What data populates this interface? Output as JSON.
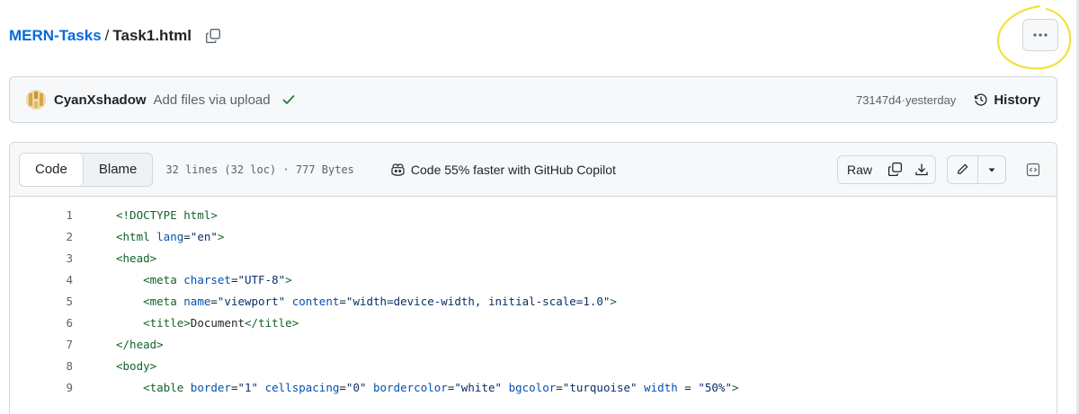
{
  "breadcrumb": {
    "repo": "MERN-Tasks",
    "separator": "/",
    "file": "Task1.html"
  },
  "commit": {
    "author": "CyanXshadow",
    "message": "Add files via upload",
    "sha": "73147d4",
    "separator": " · ",
    "time": "yesterday",
    "history_label": "History"
  },
  "file_header": {
    "tabs": [
      {
        "label": "Code"
      },
      {
        "label": "Blame"
      }
    ],
    "info": "32 lines (32 loc) · 777 Bytes",
    "copilot": "Code 55% faster with GitHub Copilot",
    "raw_label": "Raw"
  },
  "code_lines": [
    {
      "n": "1",
      "tokens": [
        {
          "t": "<!DOCTYPE html>",
          "c": "tg"
        }
      ]
    },
    {
      "n": "2",
      "tokens": [
        {
          "t": "<html ",
          "c": "tg"
        },
        {
          "t": "lang",
          "c": "at"
        },
        {
          "t": "=",
          "c": "tx"
        },
        {
          "t": "\"en\"",
          "c": "st"
        },
        {
          "t": ">",
          "c": "tg"
        }
      ]
    },
    {
      "n": "3",
      "tokens": [
        {
          "t": "<head>",
          "c": "tg"
        }
      ]
    },
    {
      "n": "4",
      "tokens": [
        {
          "t": "    ",
          "c": "tx"
        },
        {
          "t": "<meta ",
          "c": "tg"
        },
        {
          "t": "charset",
          "c": "at"
        },
        {
          "t": "=",
          "c": "tx"
        },
        {
          "t": "\"UTF-8\"",
          "c": "st"
        },
        {
          "t": ">",
          "c": "tg"
        }
      ]
    },
    {
      "n": "5",
      "tokens": [
        {
          "t": "    ",
          "c": "tx"
        },
        {
          "t": "<meta ",
          "c": "tg"
        },
        {
          "t": "name",
          "c": "at"
        },
        {
          "t": "=",
          "c": "tx"
        },
        {
          "t": "\"viewport\"",
          "c": "st"
        },
        {
          "t": " ",
          "c": "tx"
        },
        {
          "t": "content",
          "c": "at"
        },
        {
          "t": "=",
          "c": "tx"
        },
        {
          "t": "\"width=device-width, initial-scale=1.0\"",
          "c": "st"
        },
        {
          "t": ">",
          "c": "tg"
        }
      ]
    },
    {
      "n": "6",
      "tokens": [
        {
          "t": "    ",
          "c": "tx"
        },
        {
          "t": "<title>",
          "c": "tg"
        },
        {
          "t": "Document",
          "c": "tx"
        },
        {
          "t": "</title>",
          "c": "tg"
        }
      ]
    },
    {
      "n": "7",
      "tokens": [
        {
          "t": "</head>",
          "c": "tg"
        }
      ]
    },
    {
      "n": "8",
      "tokens": [
        {
          "t": "<body>",
          "c": "tg"
        }
      ]
    },
    {
      "n": "9",
      "tokens": [
        {
          "t": "    ",
          "c": "tx"
        },
        {
          "t": "<table ",
          "c": "tg"
        },
        {
          "t": "border",
          "c": "at"
        },
        {
          "t": "=",
          "c": "tx"
        },
        {
          "t": "\"1\"",
          "c": "st"
        },
        {
          "t": " ",
          "c": "tx"
        },
        {
          "t": "cellspacing",
          "c": "at"
        },
        {
          "t": "=",
          "c": "tx"
        },
        {
          "t": "\"0\"",
          "c": "st"
        },
        {
          "t": " ",
          "c": "tx"
        },
        {
          "t": "bordercolor",
          "c": "at"
        },
        {
          "t": "=",
          "c": "tx"
        },
        {
          "t": "\"white\"",
          "c": "st"
        },
        {
          "t": " ",
          "c": "tx"
        },
        {
          "t": "bgcolor",
          "c": "at"
        },
        {
          "t": "=",
          "c": "tx"
        },
        {
          "t": "\"turquoise\"",
          "c": "st"
        },
        {
          "t": " ",
          "c": "tx"
        },
        {
          "t": "width",
          "c": "at"
        },
        {
          "t": " = ",
          "c": "tx"
        },
        {
          "t": "\"50%\"",
          "c": "st"
        },
        {
          "t": ">",
          "c": "tg"
        }
      ]
    }
  ],
  "colors": {
    "link": "#0969da",
    "tag": "#116329",
    "attr": "#0550ae",
    "string": "#0a3069",
    "check": "#1a7f37",
    "annotation": "#f2e13a"
  },
  "icons": [
    "copy-icon",
    "kebab-icon",
    "check-icon",
    "history-icon",
    "copilot-icon",
    "download-icon",
    "pencil-icon",
    "triangle-down-icon",
    "code-square-icon"
  ]
}
